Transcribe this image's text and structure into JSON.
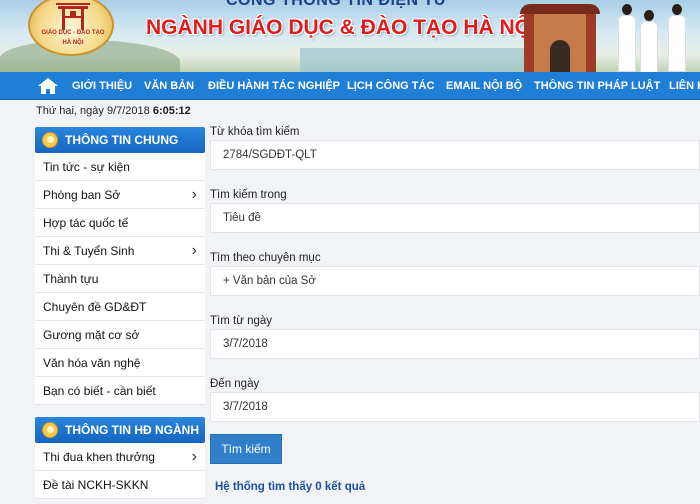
{
  "header": {
    "subtitle": "CỔNG THÔNG TIN ĐIỆN TỬ",
    "title": "NGÀNH GIÁO DỤC & ĐÀO TẠO HÀ NỘI",
    "logo_line1": "GIÁO DỤC - ĐÀO TẠO",
    "logo_line2": "HÀ NỘI"
  },
  "nav": {
    "home_icon": "home-icon",
    "items": [
      "GIỚI THIỆU",
      "VĂN BẢN",
      "ĐIỀU HÀNH TÁC NGHIỆP",
      "LỊCH CÔNG TÁC",
      "EMAIL NỘI BỘ",
      "THÔNG TIN PHÁP LUẬT",
      "LIÊN H"
    ]
  },
  "datebar": {
    "date": "Thứ hai, ngày 9/7/2018",
    "time": "6:05:12"
  },
  "sidebar": {
    "section1_title": "THÔNG TIN CHUNG",
    "section1_items": [
      {
        "label": "Tin tức - sự kiện"
      },
      {
        "label": "Phòng ban Sở"
      },
      {
        "label": "Hợp tác quốc tế"
      },
      {
        "label": "Thi & Tuyển Sinh"
      },
      {
        "label": "Thành tựu"
      },
      {
        "label": "Chuyên đề GD&ĐT"
      },
      {
        "label": "Gương mặt cơ sở"
      },
      {
        "label": "Văn hóa văn nghệ"
      },
      {
        "label": "Bạn có biết - cần biết"
      }
    ],
    "section2_title": "THÔNG TIN HĐ NGÀNH",
    "section2_items": [
      {
        "label": "Thi đua khen thưởng"
      },
      {
        "label": "Đề tài NCKH-SKKN"
      }
    ]
  },
  "form": {
    "keyword_label": "Từ khóa tìm kiếm",
    "keyword_value": "2784/SGDĐT-QLT",
    "searchin_label": "Tìm kiếm trong",
    "searchin_value": "Tiêu đề",
    "category_label": "Tìm theo chuyên mục",
    "category_value": "+ Văn bản của Sở",
    "from_label": "Tìm từ ngày",
    "from_value": "3/7/2018",
    "to_label": "Đến ngày",
    "to_value": "3/7/2018",
    "search_button": "Tìm kiếm",
    "result_text": "Hệ thống tìm thấy 0 kết quả"
  },
  "colors": {
    "nav": "#1f7fd6",
    "title_red": "#e11b1b",
    "button": "#2f80c9"
  }
}
